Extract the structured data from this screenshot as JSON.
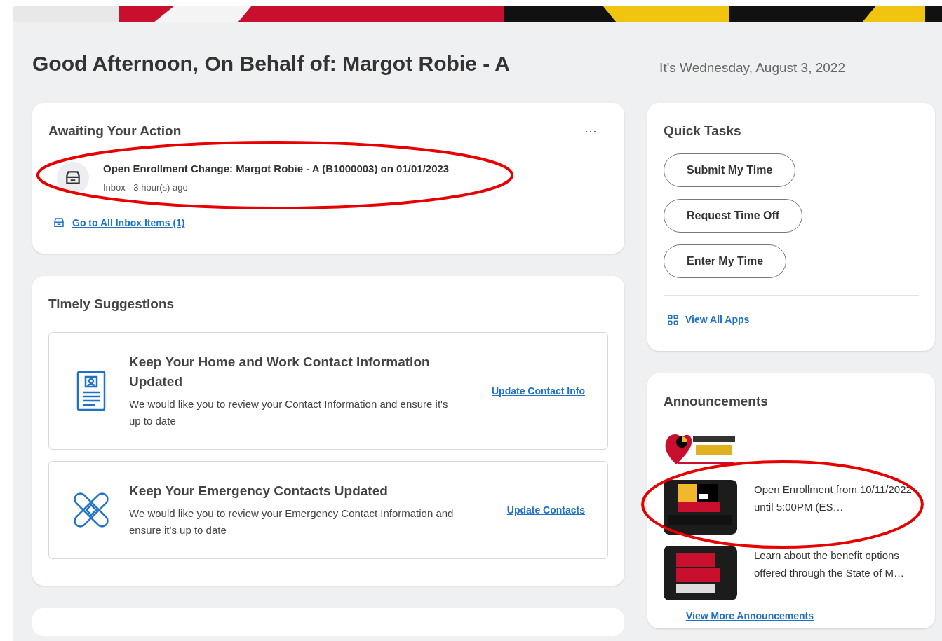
{
  "greeting": "Good Afternoon, On Behalf of: Margot Robie - A",
  "date": "It's Wednesday, August 3, 2022",
  "awaiting": {
    "title": "Awaiting Your Action",
    "more": "···",
    "items": [
      {
        "title": "Open Enrollment Change: Margot Robie - A (B1000003) on 01/01/2023",
        "meta": "Inbox - 3 hour(s) ago",
        "highlighted": true
      }
    ],
    "link": "Go to All Inbox Items (1)"
  },
  "suggestions": {
    "title": "Timely Suggestions",
    "items": [
      {
        "kind": "contact",
        "title": "Keep Your Home and Work Contact Information Updated",
        "text": "We would like you to review your Contact Information and ensure it's up to date",
        "action": "Update Contact Info"
      },
      {
        "kind": "bandage",
        "title": "Keep Your Emergency Contacts Updated",
        "text": "We would like you to review your Emergency Contact Information and ensure it's up to date",
        "action": "Update Contacts"
      }
    ]
  },
  "quick_tasks": {
    "title": "Quick Tasks",
    "buttons": [
      "Submit My Time",
      "Request Time Off",
      "Enter My Time"
    ],
    "link": "View All Apps"
  },
  "announcements": {
    "title": "Announcements",
    "items": [
      {
        "kind": "logo",
        "highlighted": false
      },
      {
        "kind": "tile",
        "text": "Open Enrollment from 10/11/2022 until 5:00PM (ES…",
        "highlighted": true
      },
      {
        "kind": "tile",
        "text": "Learn about the benefit options offered through the State of M…",
        "highlighted": false
      }
    ],
    "link": "View More Announcements"
  }
}
